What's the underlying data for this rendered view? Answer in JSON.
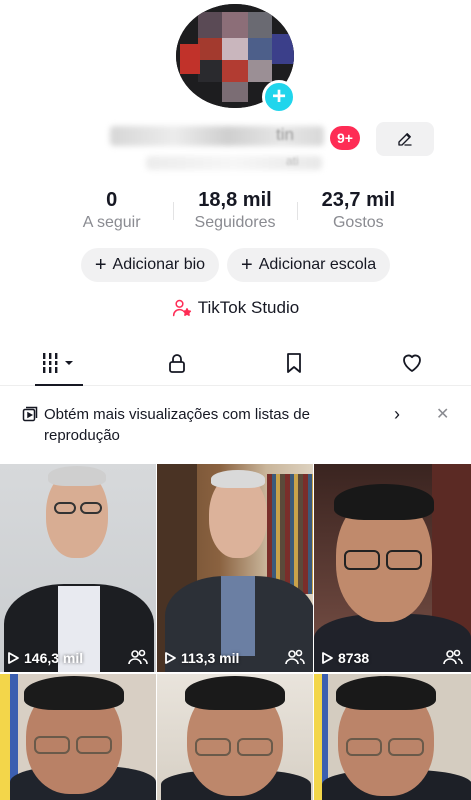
{
  "profile": {
    "badge": "9+",
    "name_visible_fragment": "tin",
    "sub_visible_fragment": "ati",
    "edit_icon": "pencil-icon",
    "add_avatar_icon": "plus-icon"
  },
  "stats": [
    {
      "value": "0",
      "label": "A seguir"
    },
    {
      "value": "18,8 mil",
      "label": "Seguidores"
    },
    {
      "value": "23,7 mil",
      "label": "Gostos"
    }
  ],
  "actions": {
    "add_bio": "Adicionar bio",
    "add_school": "Adicionar escola",
    "plus": "+"
  },
  "studio": {
    "label": "TikTok Studio",
    "icon": "person-star-icon"
  },
  "tabs": [
    {
      "icon": "videos-grid-icon",
      "active": true
    },
    {
      "icon": "lock-icon",
      "active": false
    },
    {
      "icon": "bookmark-icon",
      "active": false
    },
    {
      "icon": "heart-icon",
      "active": false
    }
  ],
  "banner": {
    "text": "Obtém mais visualizações com listas de reprodução",
    "chevron": "›",
    "close": "✕"
  },
  "videos": [
    {
      "views": "146,3 mil"
    },
    {
      "views": "113,3 mil"
    },
    {
      "views": "8738"
    },
    {
      "views": ""
    },
    {
      "views": ""
    },
    {
      "views": ""
    }
  ],
  "colors": {
    "accent": "#fe2c55",
    "avatar_plus": "#20d5ec",
    "text": "#161823",
    "muted": "#8a8b91",
    "pill_bg": "#f1f1f2"
  }
}
